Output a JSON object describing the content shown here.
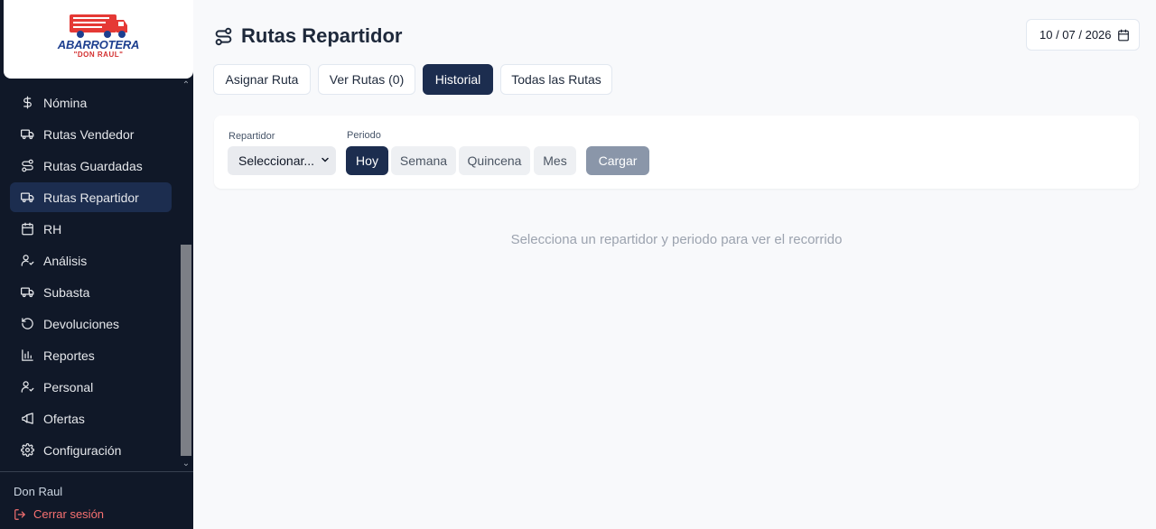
{
  "brand": {
    "line1": "ABARROTERA",
    "line2": "\"DON RAUL\"",
    "primary_color": "#1d3f8f",
    "accent_color": "#d32f2f"
  },
  "sidebar": {
    "items": [
      {
        "label": "Nómina",
        "icon": "dollar-icon",
        "active": false
      },
      {
        "label": "Rutas Vendedor",
        "icon": "truck-icon",
        "active": false
      },
      {
        "label": "Rutas Guardadas",
        "icon": "route-icon",
        "active": false
      },
      {
        "label": "Rutas Repartidor",
        "icon": "truck-icon",
        "active": true
      },
      {
        "label": "RH",
        "icon": "calendar-icon",
        "active": false
      },
      {
        "label": "Análisis",
        "icon": "user-check-icon",
        "active": false
      },
      {
        "label": "Subasta",
        "icon": "truck-icon",
        "active": false
      },
      {
        "label": "Devoluciones",
        "icon": "rotate-ccw-icon",
        "active": false
      },
      {
        "label": "Reportes",
        "icon": "bar-chart-icon",
        "active": false
      },
      {
        "label": "Personal",
        "icon": "user-check-icon",
        "active": false
      },
      {
        "label": "Ofertas",
        "icon": "megaphone-icon",
        "active": false
      },
      {
        "label": "Configuración",
        "icon": "gear-icon",
        "active": false
      }
    ],
    "user_name": "Don Raul",
    "logout_label": "Cerrar sesión"
  },
  "header": {
    "title": "Rutas Repartidor",
    "title_icon": "route-icon",
    "date": "10 / 07 / 2026"
  },
  "tabs": [
    {
      "label": "Asignar Ruta",
      "active": false
    },
    {
      "label": "Ver Rutas (0)",
      "active": false
    },
    {
      "label": "Historial",
      "active": true
    },
    {
      "label": "Todas las Rutas",
      "active": false
    }
  ],
  "filters": {
    "repartidor_label": "Repartidor",
    "repartidor_value": "Seleccionar...",
    "periodo_label": "Periodo",
    "periods": [
      {
        "label": "Hoy",
        "active": true
      },
      {
        "label": "Semana",
        "active": false
      },
      {
        "label": "Quincena",
        "active": false
      },
      {
        "label": "Mes",
        "active": false
      }
    ],
    "load_label": "Cargar"
  },
  "empty_message": "Selecciona un repartidor y periodo para ver el recorrido"
}
